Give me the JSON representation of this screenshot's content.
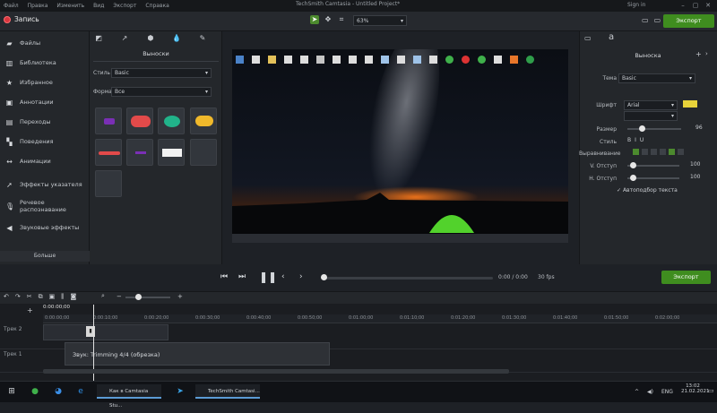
{
  "menubar": {
    "items": [
      "Файл",
      "Правка",
      "Изменить",
      "Вид",
      "Экспорт",
      "Справка"
    ],
    "title": "TechSmith Camtasia - Untitled Project*",
    "sign_in": "Sign in"
  },
  "toolbar": {
    "record_label": "Запись",
    "zoom_value": "63%",
    "share_label": "Экспорт"
  },
  "leftnav": {
    "items": [
      {
        "label": "Файлы",
        "icon": "folder-icon"
      },
      {
        "label": "Библиотека",
        "icon": "library-icon"
      },
      {
        "label": "Избранное",
        "icon": "star-icon"
      },
      {
        "label": "Аннотации",
        "icon": "annotation-icon"
      },
      {
        "label": "Переходы",
        "icon": "transition-icon"
      },
      {
        "label": "Поведения",
        "icon": "behavior-icon"
      },
      {
        "label": "Анимации",
        "icon": "animation-icon"
      },
      {
        "label": "Эффекты указателя",
        "icon": "cursor-effect-icon"
      },
      {
        "label": "Речевое распознавание",
        "icon": "voice-icon"
      },
      {
        "label": "Звуковые эффекты",
        "icon": "audio-effect-icon"
      }
    ],
    "more_label": "Больше"
  },
  "panel": {
    "title": "Выноски",
    "style_label": "Стиль",
    "style_value": "Basic",
    "type_label": "Форма",
    "type_value": "Все"
  },
  "props": {
    "title": "Выноска",
    "rows": [
      {
        "label": "Тема"
      },
      {
        "label": "Шрифт"
      },
      {
        "label": "Размер"
      },
      {
        "label": "Стиль"
      },
      {
        "label": "Выравнивание"
      },
      {
        "label": "V. Отступ"
      },
      {
        "label": "H. Отступ"
      }
    ],
    "theme_value": "Basic",
    "font_value": "Arial",
    "font_color": "#e8d33a",
    "size_value": "96",
    "v_value": "100",
    "h_value": "100",
    "autofit_label": "Автоподбор текста"
  },
  "playback": {
    "timecode": "0:00 / 0:00",
    "fps": "30 fps"
  },
  "timeline": {
    "playhead_time": "0:00:00;00",
    "ticks": [
      "0:00:00;00",
      "0:00:10;00",
      "0:00:20;00",
      "0:00:30;00",
      "0:00:40;00",
      "0:00:50;00",
      "0:01:00;00",
      "0:01:10;00",
      "0:01:20;00",
      "0:01:30;00",
      "0:01:40;00",
      "0:01:50;00",
      "0:02:00;00"
    ],
    "track1_label": "Трек 1",
    "track2_label": "Трек 2",
    "tooltip": "Звук: Trimming 4/4 (обрезка)"
  },
  "taskbar": {
    "app1": "Как в Camtasia Stu...",
    "app2": "TechSmith Camtasi...",
    "lang": "ENG",
    "time": "13:02",
    "date": "21.02.2021"
  },
  "colors": {
    "accent": "#3f8d1f",
    "record": "#d9363e"
  }
}
